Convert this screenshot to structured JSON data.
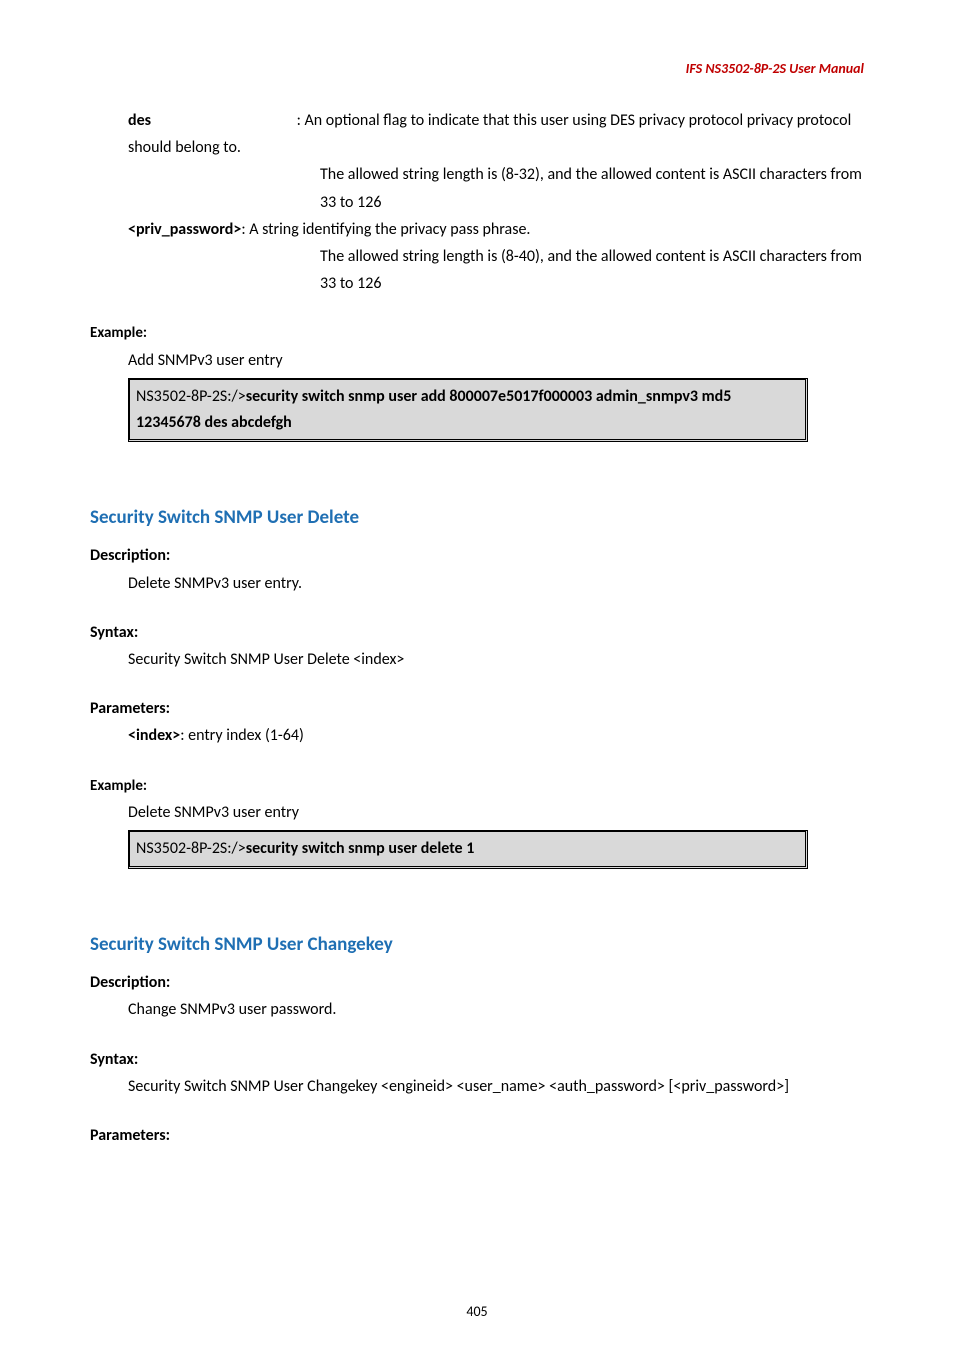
{
  "header": "IFS  NS3502-8P-2S  User  Manual",
  "p1": {
    "term": "des",
    "rest": ": An optional flag to indicate that this user using DES privacy protocol privacy protocol should belong to."
  },
  "p2": "The allowed string length is (8-32), and the allowed content is ASCII characters from 33 to 126",
  "p3_term": "<priv_password>",
  "p3_rest": ": A string identifying the privacy pass phrase.",
  "p4": "The allowed string length is (8-40), and the allowed content is ASCII characters from 33 to 126",
  "ex_label": "Example:",
  "ex1_desc": "Add SNMPv3 user entry",
  "code1_prefix": "NS3502-8P-2S:/>",
  "code1_cmd": "security switch snmp user add 800007e5017f000003 admin_snmpv3 md5 12345678 des abcdefgh",
  "h2a": "Security Switch SNMP User Delete",
  "desc_label": "Description:",
  "desc_a": "Delete SNMPv3 user entry.",
  "syn_label": "Syntax:",
  "syn_a": "Security Switch SNMP User Delete <index>",
  "param_label": "Parameters:",
  "param_a_term": "<index>",
  "param_a_rest": ": entry index (1-64)",
  "ex2_desc": "Delete SNMPv3 user entry",
  "code2_prefix": "NS3502-8P-2S:/>",
  "code2_cmd": "security switch snmp user delete 1",
  "h2b": "Security Switch SNMP User Changekey",
  "desc_b": "Change SNMPv3 user password.",
  "syn_b": "Security Switch SNMP User Changekey <engineid> <user_name> <auth_password> [<priv_password>]",
  "pagenum": "405"
}
